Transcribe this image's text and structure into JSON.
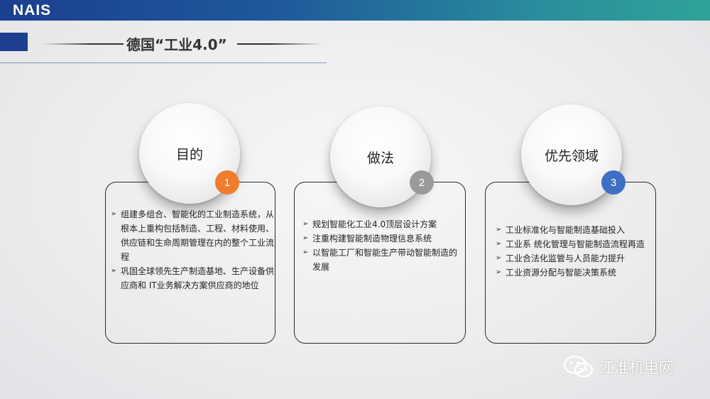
{
  "header": {
    "logo": "NAIS"
  },
  "slide": {
    "title": "德国“工业4.0”"
  },
  "cards": [
    {
      "heading": "目的",
      "number": "1",
      "badge_color": "#ef7d2e",
      "bullets": [
        "组建多组合、智能化的工业制造系统，从根本上重构包括制造、工程、材料使用、 供应链和生命周期管理在内的整个工业流程",
        "巩固全球领先生产制造基地、生产设备供应商和 IT业务解决方案供应商的地位"
      ]
    },
    {
      "heading": "做法",
      "number": "2",
      "badge_color": "#9a9a9a",
      "bullets": [
        "规划智能化工业4.0顶层设计方案",
        "注重构建智能制造物理信息系统",
        "以智能工厂和智能生产带动智能制造的发展"
      ]
    },
    {
      "heading": "优先领域",
      "number": "3",
      "badge_color": "#3f6fc4",
      "bullets": [
        "工业标准化与智能制造基础投入",
        "工业系 统化管理与智能制造流程再造",
        "工业合法化监管与人员能力提升",
        "工业资源分配与智能决策系统"
      ]
    }
  ],
  "watermark": {
    "text": "江淮机电网",
    "icon": "wechat-icon"
  }
}
